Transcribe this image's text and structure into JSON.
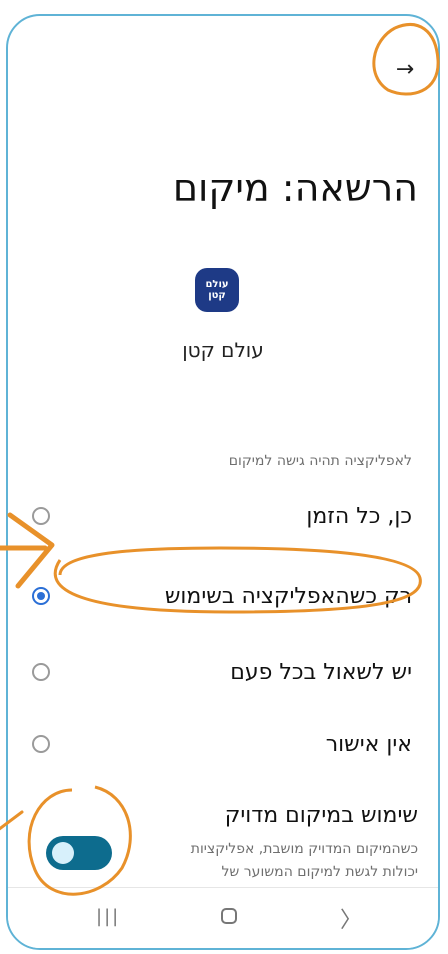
{
  "header": {
    "back_icon": "arrow-right-icon",
    "back_glyph": "→"
  },
  "title": "הרשאה: מיקום",
  "app": {
    "icon_text_top": "עולם",
    "icon_text_bottom": "קטן",
    "name": "עולם קטן",
    "icon_color": "#1e3a86"
  },
  "section_label": "לאפליקציה תהיה גישה למיקום",
  "options": [
    {
      "label": "כן, כל הזמן",
      "selected": false
    },
    {
      "label": "רק כשהאפליקציה בשימוש",
      "selected": true
    },
    {
      "label": "יש לשאול בכל פעם",
      "selected": false
    },
    {
      "label": "אין אישור",
      "selected": false
    }
  ],
  "precise": {
    "title": "שימוש במיקום מדויק",
    "description": "כשהמיקום המדויק מושבת, אפליקציות יכולות לגשת למיקום המשוער של המכשיר",
    "enabled": true
  },
  "navbar": {
    "recent_glyph": "|||",
    "back_glyph": "〉"
  },
  "colors": {
    "accent": "#2b6fd6",
    "toggle": "#0d6c8e",
    "annotation": "#e8912a",
    "frame": "#5fb3d6"
  }
}
